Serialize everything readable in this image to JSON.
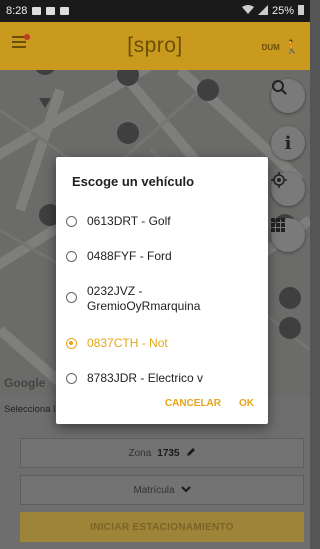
{
  "status_bar": {
    "time": "8:28",
    "battery": "25%"
  },
  "app_bar": {
    "brand": "[spro]",
    "user": "DUM"
  },
  "map": {
    "attribution": "Google",
    "fab_buttons": [
      "Q",
      "i",
      "◎",
      "▦"
    ]
  },
  "form": {
    "hint": "Selecciona la zona donde estás y la matrícula de tu vehículo",
    "zone_label": "Zona",
    "zone_value": "1735",
    "plate_label": "Matrícula",
    "start_button": "INICIAR ESTACIONAMIENTO"
  },
  "dialog": {
    "title": "Escoge un vehículo",
    "options": [
      {
        "label": "0613DRT - Golf",
        "selected": false
      },
      {
        "label": "0488FYF - Ford",
        "selected": false
      },
      {
        "label": "0232JVZ - GremioOyRmarquina",
        "selected": false
      },
      {
        "label": "0837CTH - Not",
        "selected": true
      },
      {
        "label": "8783JDR - Electrico v",
        "selected": false
      }
    ],
    "cancel": "CANCELAR",
    "ok": "OK"
  },
  "colors": {
    "accent": "#e6a517",
    "app_bar": "#c99a1d"
  }
}
